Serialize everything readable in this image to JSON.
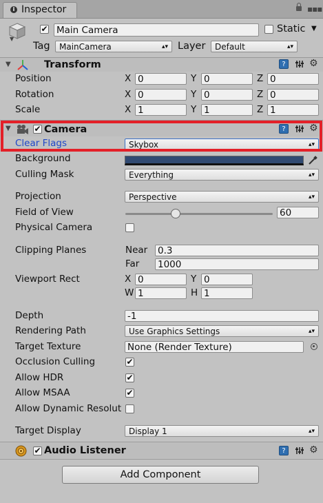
{
  "tab": {
    "label": "Inspector"
  },
  "object": {
    "active": true,
    "name": "Main Camera",
    "static_label": "Static",
    "tag_label": "Tag",
    "tag_value": "MainCamera",
    "layer_label": "Layer",
    "layer_value": "Default"
  },
  "transform": {
    "title": "Transform",
    "position_label": "Position",
    "rotation_label": "Rotation",
    "scale_label": "Scale",
    "x": "X",
    "y": "Y",
    "z": "Z",
    "position": [
      "0",
      "0",
      "0"
    ],
    "rotation": [
      "0",
      "0",
      "0"
    ],
    "scale": [
      "1",
      "1",
      "1"
    ]
  },
  "camera": {
    "title": "Camera",
    "enabled": true,
    "clear_flags_label": "Clear Flags",
    "clear_flags_value": "Skybox",
    "background_label": "Background",
    "background_color": "#314a72",
    "culling_mask_label": "Culling Mask",
    "culling_mask_value": "Everything",
    "projection_label": "Projection",
    "projection_value": "Perspective",
    "fov_label": "Field of View",
    "fov_value": "60",
    "physical_camera_label": "Physical Camera",
    "clipping_planes_label": "Clipping Planes",
    "near_label": "Near",
    "near_value": "0.3",
    "far_label": "Far",
    "far_value": "1000",
    "viewport_rect_label": "Viewport Rect",
    "x": "X",
    "y": "Y",
    "w": "W",
    "h": "H",
    "viewport_x": "0",
    "viewport_y": "0",
    "viewport_w": "1",
    "viewport_h": "1",
    "depth_label": "Depth",
    "depth_value": "-1",
    "rendering_path_label": "Rendering Path",
    "rendering_path_value": "Use Graphics Settings",
    "target_texture_label": "Target Texture",
    "target_texture_value": "None (Render Texture)",
    "occlusion_culling_label": "Occlusion Culling",
    "allow_hdr_label": "Allow HDR",
    "allow_msaa_label": "Allow MSAA",
    "allow_dynamic_label": "Allow Dynamic Resolut",
    "target_display_label": "Target Display",
    "target_display_value": "Display 1"
  },
  "audio_listener": {
    "title": "Audio Listener",
    "enabled": true
  },
  "add_component_label": "Add Component",
  "highlight_color": "#e32028",
  "accent_color": "#2f6eb0"
}
